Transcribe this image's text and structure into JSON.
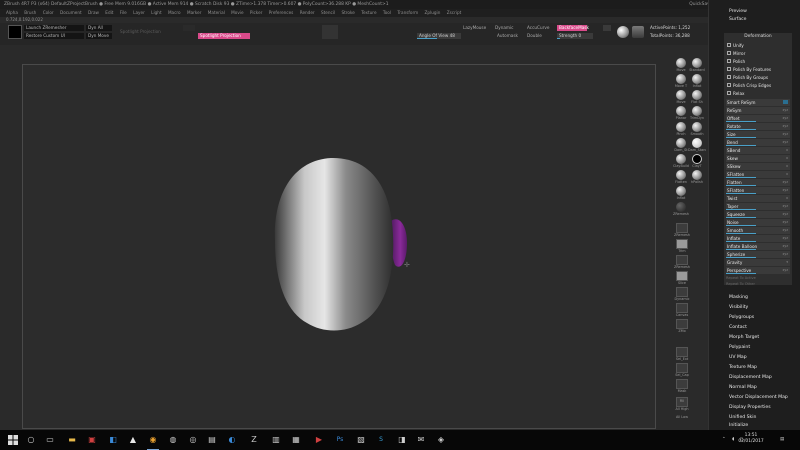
{
  "window": {
    "title": "ZBrush 4R7 P3 (x64)    DefaultZProjectBrush   ● Free Mem 9.016GB ● Active Mem 914 ● Scratch Disk 93 ● ZTime>1.378 Timer>0.607 ● PolyCount>36.288 KP ● MeshCount>1",
    "right_controls": "QuickSave   See-through 0   Menus   DefaultZScript"
  },
  "menubar": {
    "items": [
      "Alpha",
      "Brush",
      "Color",
      "Document",
      "Draw",
      "Edit",
      "File",
      "Layer",
      "Light",
      "Macro",
      "Marker",
      "Material",
      "Movie",
      "Picker",
      "Preferences",
      "Render",
      "Stencil",
      "Stroke",
      "Texture",
      "Tool",
      "Transform",
      "Zplugin",
      "Zscript"
    ]
  },
  "coords": "0.724,0.192,0.022",
  "topshelf": {
    "launch_zremesher": "Launch ZRemesher",
    "restore_custom_ui": "Restore Custom UI",
    "dyn_all": "Dyn All",
    "dyn_move": "Dyn Move",
    "spotlight_projection": "Spotlight Projection",
    "projection_dim": "Spotlight Projection",
    "lazymouse": "LazyMouse",
    "dynamic": "Dynamic",
    "accucurve": "AccuCurve",
    "backface": "BackfaceMask",
    "angle_of_view": "Angle Of View 48",
    "automask": "Automask",
    "double": "Double",
    "strength": "Strength 0",
    "active_points": "ActivePoints: 1,252",
    "total_points": "TotalPoints: 36,288"
  },
  "rightshelf": {
    "tools": [
      "Move",
      "Standard",
      "Move T",
      "Inflat",
      "Move",
      "Flat Sh",
      "Planar",
      "TrimDyn",
      "Pinch",
      "Smooth",
      "Dam_St",
      "Dam_Standard",
      "ClayBuild",
      "ClayT",
      "Flatten",
      "hPolish",
      "Inflat",
      "ZRemesh"
    ],
    "rows": [
      "ZRemesh",
      "Trim",
      "ZRemesh",
      "Slice",
      "Dynamic",
      "Canvas",
      "ZMo",
      "Sel_Ext",
      "Sel_Cap",
      "Mask",
      "Layer",
      "Rect",
      "Select",
      "Move",
      "Scale",
      "Rotate",
      "Sub",
      "Polyf",
      "Fill",
      "All High",
      "All Low"
    ]
  },
  "sidebar": {
    "top_items": [
      "Preview",
      "Surface"
    ],
    "deformation": {
      "title": "Deformation",
      "checkboxes": [
        "Unify",
        "Mirror",
        "Polish",
        "Polish By Features",
        "Polish By Groups",
        "Polish Crisp Edges",
        "Relax"
      ],
      "smart_resym": "Smart ReSym",
      "sliders": [
        "ReSym",
        "Offset",
        "Rotate",
        "Size",
        "Bend",
        "SBend",
        "Skew",
        "SSkew",
        "SFlatten",
        "Flatten",
        "SFlatten",
        "Twist",
        "Taper",
        "Squeeze",
        "Noise",
        "Smooth",
        "Inflate",
        "Inflate Balloon",
        "Spherize",
        "Gravity",
        "Perspective"
      ],
      "repeat_active": "Repeat To Active",
      "repeat_other": "Repeat To Other"
    },
    "items": [
      "Masking",
      "Visibility",
      "Polygroups",
      "Contact",
      "Morph Target",
      "Polypaint",
      "UV Map",
      "Texture Map",
      "Displacement Map",
      "Normal Map",
      "Vector Displacement Map",
      "Display Properties",
      "Unified Skin",
      "Initialize"
    ]
  },
  "taskbar": {
    "start_icon": "windows-start-icon",
    "time": "13:51",
    "date": "02/01/2017",
    "lang": "ENG"
  },
  "colors": {
    "accent_pink": "#d94a8a",
    "slider_blue": "#4aa0c8",
    "model_purple": "#7a2a8a"
  }
}
